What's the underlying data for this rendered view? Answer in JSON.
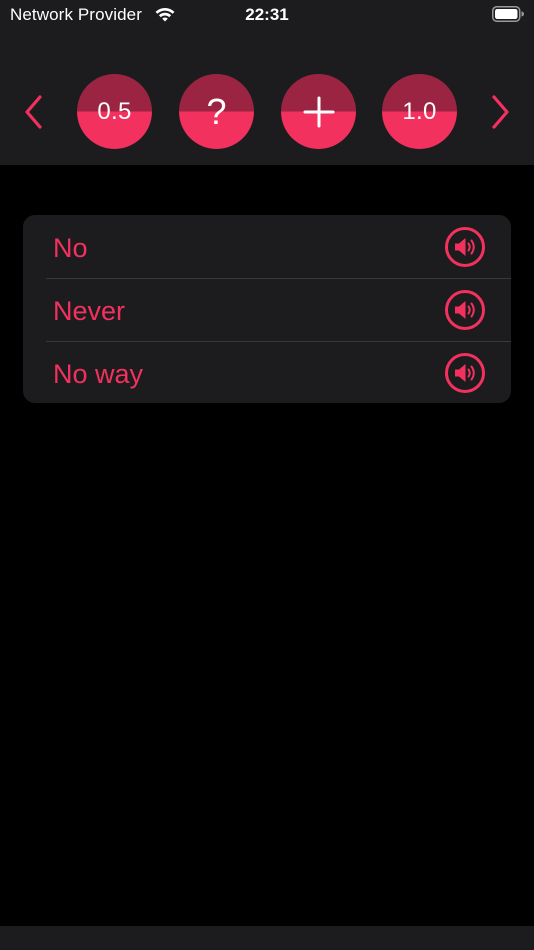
{
  "colors": {
    "accent": "#f2315e",
    "accent_dark": "#9b2443",
    "bar_background": "#1c1c1e",
    "page_background": "#000000"
  },
  "status_bar": {
    "carrier": "Network Provider",
    "time": "22:31",
    "wifi_icon": "wifi-icon",
    "battery_icon": "battery-full-icon"
  },
  "toolbar": {
    "prev_icon": "chevron-left-icon",
    "next_icon": "chevron-right-icon",
    "buttons": [
      {
        "label": "0.5",
        "icon": "speed-slow"
      },
      {
        "label": "?",
        "icon": "question-icon"
      },
      {
        "label": "+",
        "icon": "plus-icon"
      },
      {
        "label": "1.0",
        "icon": "speed-normal"
      }
    ]
  },
  "phrases": [
    {
      "text": "No",
      "icon": "speaker-icon"
    },
    {
      "text": "Never",
      "icon": "speaker-icon"
    },
    {
      "text": "No way",
      "icon": "speaker-icon"
    }
  ]
}
